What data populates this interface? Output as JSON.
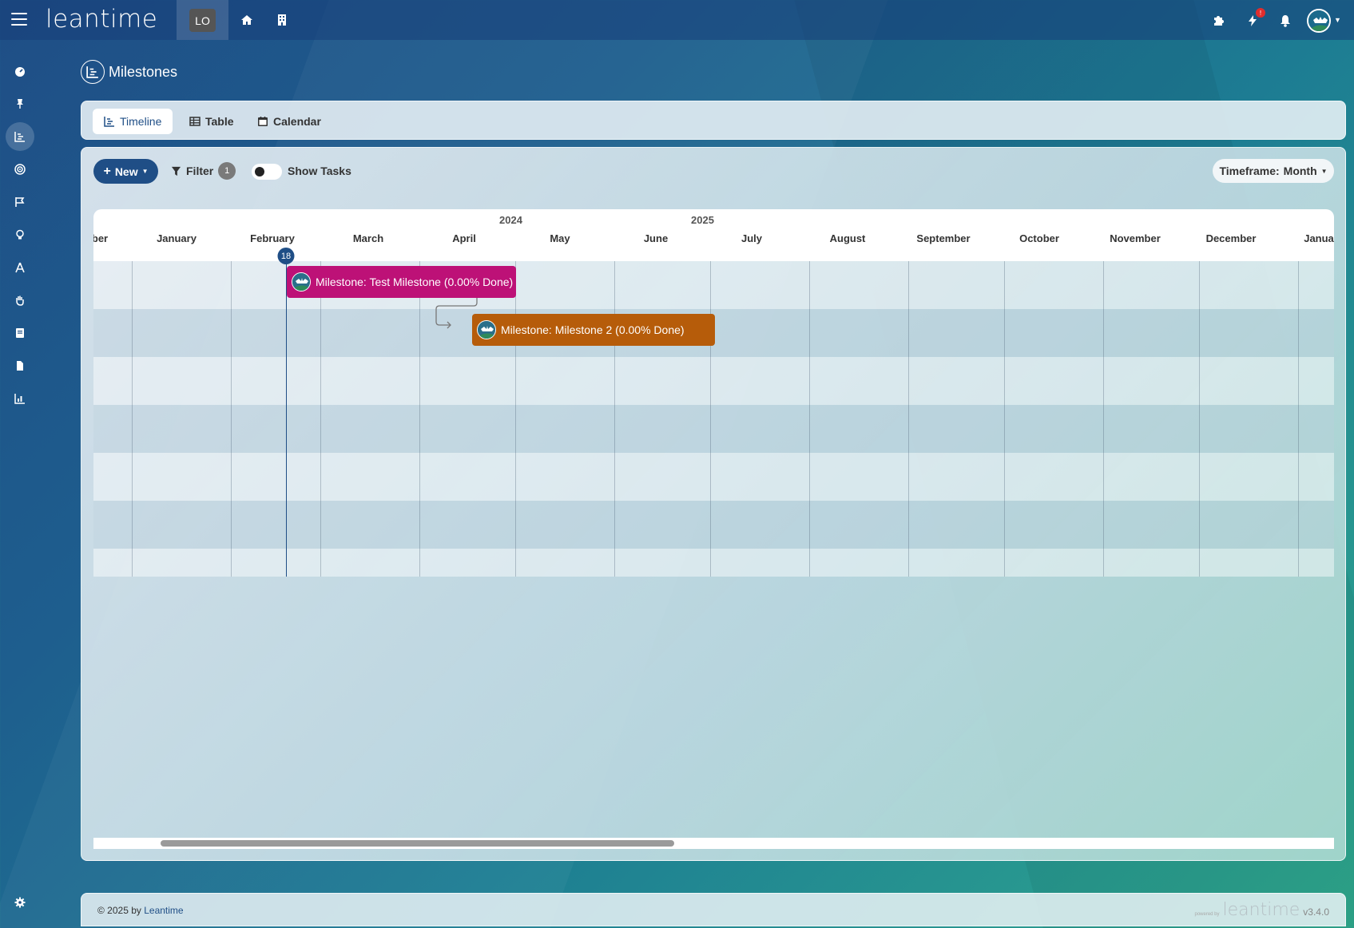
{
  "app": {
    "logo_text": "leantime",
    "project_badge": "LO"
  },
  "topbar": {
    "notification_count": "!"
  },
  "page": {
    "title": "Milestones"
  },
  "tabs": [
    {
      "label": "Timeline",
      "icon": "timeline-icon",
      "active": true
    },
    {
      "label": "Table",
      "icon": "table-icon",
      "active": false
    },
    {
      "label": "Calendar",
      "icon": "calendar-icon",
      "active": false
    }
  ],
  "toolbar": {
    "new_label": "New",
    "filter_label": "Filter",
    "filter_count": "1",
    "show_tasks_label": "Show Tasks",
    "show_tasks_on": false,
    "timeframe_label": "Timeframe:",
    "timeframe_value": "Month"
  },
  "gantt": {
    "years": [
      "2024",
      "2025"
    ],
    "months": [
      "ber",
      "January",
      "February",
      "March",
      "April",
      "May",
      "June",
      "July",
      "August",
      "September",
      "October",
      "November",
      "December",
      "Janua"
    ],
    "today_day": "18",
    "milestones": [
      {
        "label": "Milestone: Test Milestone (0.00% Done)",
        "color": "#bd1177"
      },
      {
        "label": "Milestone: Milestone 2 (0.00% Done)",
        "color": "#b65c0a"
      }
    ]
  },
  "footer": {
    "copyright": "© 2025 by",
    "link_text": "Leantime",
    "powered_by": "powered by",
    "logo_text": "leantime",
    "version": "v3.4.0"
  },
  "colors": {
    "brand": "#1f4e86",
    "milestone_1": "#bd1177",
    "milestone_2": "#b65c0a"
  }
}
